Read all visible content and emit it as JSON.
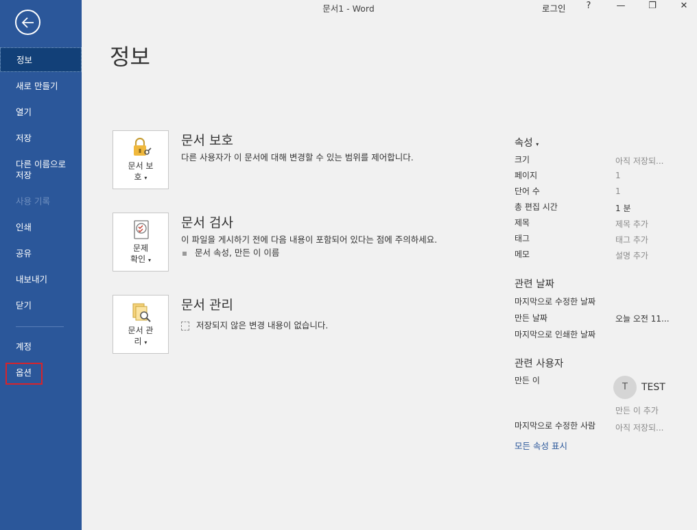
{
  "window": {
    "title": "문서1  -  Word",
    "login": "로그인",
    "help": "?",
    "minimize": "—",
    "restore": "❐",
    "close": "✕"
  },
  "sidebar": {
    "items": [
      {
        "label": "정보"
      },
      {
        "label": "새로 만들기"
      },
      {
        "label": "열기"
      },
      {
        "label": "저장"
      },
      {
        "label": "다른 이름으로\n저장"
      },
      {
        "label": "사용 기록"
      },
      {
        "label": "인쇄"
      },
      {
        "label": "공유"
      },
      {
        "label": "내보내기"
      },
      {
        "label": "닫기"
      },
      {
        "label": "계정"
      },
      {
        "label": "옵션"
      }
    ]
  },
  "page": {
    "title": "정보"
  },
  "sections": {
    "protect": {
      "button_line1": "문서 보",
      "button_line2": "호",
      "title": "문서 보호",
      "desc": "다른 사용자가 이 문서에 대해 변경할 수 있는 범위를 제어합니다."
    },
    "inspect": {
      "button_line1": "문제",
      "button_line2": "확인",
      "title": "문서 검사",
      "desc": "이 파일을 게시하기 전에 다음 내용이 포함되어 있다는 점에 주의하세요.",
      "bullet": "문서 속성, 만든 이 이름"
    },
    "manage": {
      "button_line1": "문서 관",
      "button_line2": "리",
      "title": "문서 관리",
      "desc": "저장되지 않은 변경 내용이 없습니다."
    }
  },
  "properties": {
    "heading": "속성",
    "size_label": "크기",
    "size_value": "아직 저장되...",
    "pages_label": "페이지",
    "pages_value": "1",
    "words_label": "단어 수",
    "words_value": "1",
    "edit_time_label": "총 편집 시간",
    "edit_time_value": "1 분",
    "title_label": "제목",
    "title_value": "제목 추가",
    "tags_label": "태그",
    "tags_value": "태그 추가",
    "comments_label": "메모",
    "comments_value": "설명 추가"
  },
  "dates": {
    "heading": "관련 날짜",
    "modified_label": "마지막으로 수정한 날짜",
    "created_label": "만든 날짜",
    "created_value": "오늘 오전 11...",
    "printed_label": "마지막으로 인쇄한 날짜"
  },
  "people": {
    "heading": "관련 사용자",
    "author_label": "만든 이",
    "avatar_initial": "T",
    "author_name": "TEST",
    "add_author": "만든 이 추가",
    "last_modified_label": "마지막으로 수정한 사람",
    "last_modified_value": "아직 저장되..."
  },
  "show_all": "모든 속성 표시",
  "colors": {
    "sidebar": "#2b579a",
    "active": "#124078",
    "highlight": "#d8232a"
  }
}
